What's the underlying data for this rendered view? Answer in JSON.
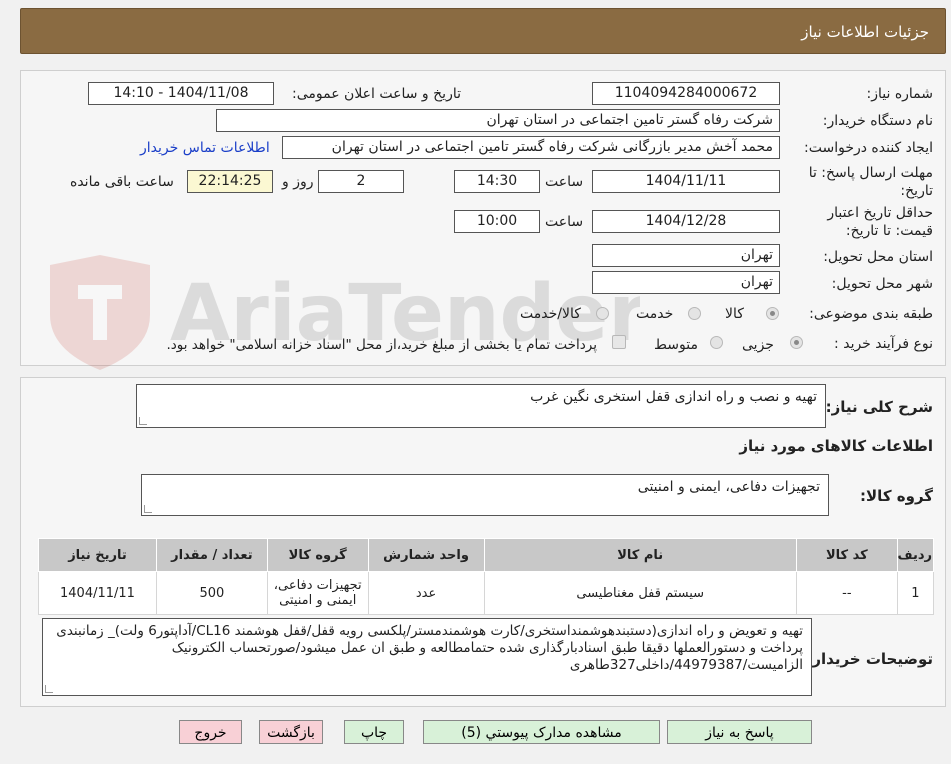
{
  "header": {
    "title": "جزئیات اطلاعات نیاز"
  },
  "form": {
    "need_number_label": "شماره نیاز:",
    "need_number": "1104094284000672",
    "announce_label": "تاریخ و ساعت اعلان عمومی:",
    "announce_value": "1404/11/08 - 14:10",
    "buyer_label": "نام دستگاه خریدار:",
    "buyer_value": "شرکت رفاه گستر تامین اجتماعی در استان تهران",
    "creator_label": "ایجاد کننده درخواست:",
    "creator_value": "محمد آخش مدیر بازرگانی شرکت رفاه گستر تامین اجتماعی در استان تهران",
    "contact_link": "اطلاعات تماس خریدار",
    "deadline_label_1": "مهلت ارسال پاسخ: تا",
    "deadline_label_2": "تاریخ:",
    "deadline_date": "1404/11/11",
    "time_label": "ساعت",
    "deadline_time": "14:30",
    "days_value": "2",
    "days_label": "روز و",
    "remaining_time": "22:14:25",
    "remaining_label": "ساعت باقی مانده",
    "validity_label_1": "حداقل تاریخ اعتبار",
    "validity_label_2": "قیمت: تا تاریخ:",
    "validity_date": "1404/12/28",
    "validity_time_label": "ساعت",
    "validity_time": "10:00",
    "province_label": "استان محل تحویل:",
    "province_value": "تهران",
    "city_label": "شهر محل تحویل:",
    "city_value": "تهران",
    "category_label": "طبقه بندی موضوعی:",
    "category_options": [
      "کالا",
      "خدمت",
      "کالا/خدمت"
    ],
    "process_label": "نوع فرآیند خرید :",
    "process_options": [
      "جزیی",
      "متوسط"
    ],
    "payment_note": "پرداخت تمام یا بخشی از مبلغ خرید،از محل \"اسناد خزانه اسلامی\" خواهد بود."
  },
  "watermark": {
    "text": "AriaTender.neT"
  },
  "details": {
    "summary_label": "شرح کلی نیاز:",
    "summary_value": "تهیه و نصب و راه اندازی قفل استخری نگین غرب",
    "goods_info_title": "اطلاعات کالاهای مورد نیاز",
    "group_label": "گروه کالا:",
    "group_value": "تجهیزات دفاعی، ایمنی و امنیتی",
    "table": {
      "headers": [
        "ردیف",
        "کد کالا",
        "نام کالا",
        "واحد شمارش",
        "گروه کالا",
        "تعداد / مقدار",
        "تاریخ نیاز"
      ],
      "rows": [
        [
          "1",
          "--",
          "سیستم قفل مغناطیسی",
          "عدد",
          "تجهیزات دفاعی، ایمنی و امنیتی",
          "500",
          "1404/11/11"
        ]
      ]
    },
    "buyer_notes_label": "توضیحات خریدار:",
    "buyer_notes": "تهیه و تعویض و راه اندازی(دستبندهوشمنداستخری/کارت هوشمندمستر/پلکسی رویه قفل/قفل هوشمند CL16/آداپتور6 ولت)_ زمانبندی پرداخت و دستورالعملها دقیقا طبق اسنادبارگذاری شده حتمامطالعه و طبق ان عمل میشود/صورتحساب الکترونیک الزامیست/44979387/داخلی327طاهری"
  },
  "buttons": {
    "reply": "پاسخ به نیاز",
    "attachments": "مشاهده مدارک پیوستي (5)",
    "print": "چاپ",
    "back": "بازگشت",
    "exit": "خروج"
  }
}
